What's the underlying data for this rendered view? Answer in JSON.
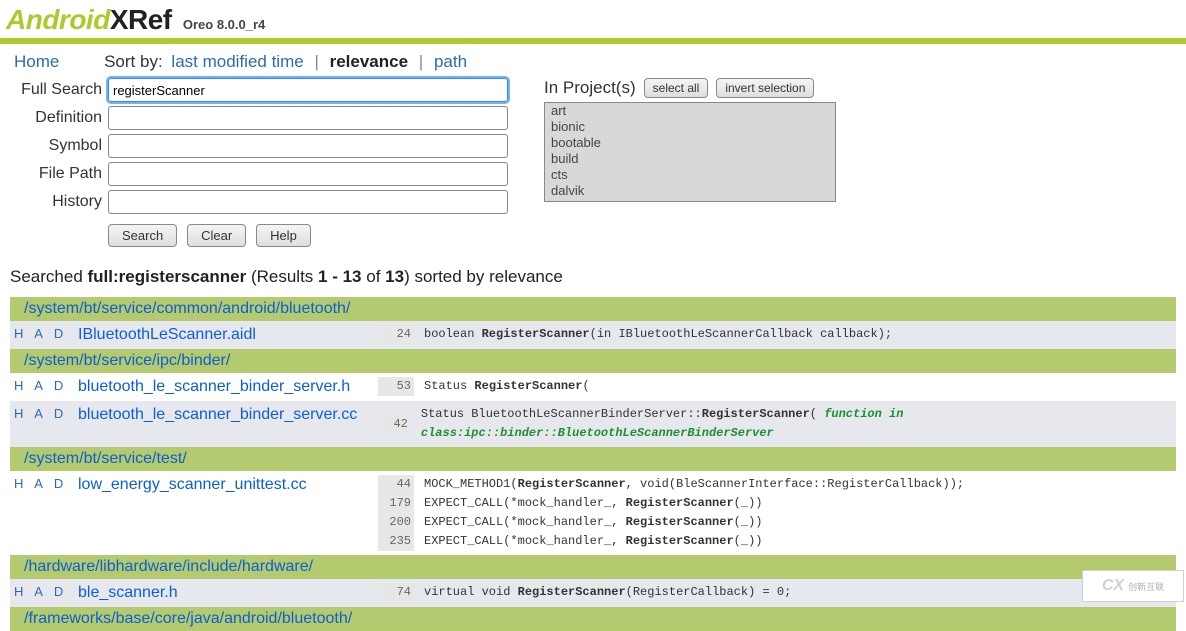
{
  "brand": {
    "part1": "Android",
    "part2": "XRef",
    "version": "Oreo 8.0.0_r4"
  },
  "nav": {
    "home": "Home",
    "sortby_label": "Sort by:",
    "sort_last": "last modified time",
    "sort_rel": "relevance",
    "sort_path": "path"
  },
  "form": {
    "labels": {
      "full": "Full Search",
      "def": "Definition",
      "symbol": "Symbol",
      "filepath": "File Path",
      "history": "History"
    },
    "values": {
      "full": "registerScanner",
      "def": "",
      "symbol": "",
      "filepath": "",
      "history": ""
    },
    "buttons": {
      "search": "Search",
      "clear": "Clear",
      "help": "Help"
    }
  },
  "projects": {
    "label": "In Project(s)",
    "select_all": "select all",
    "invert": "invert selection",
    "list": [
      "art",
      "bionic",
      "bootable",
      "build",
      "cts",
      "dalvik"
    ]
  },
  "summary": {
    "prefix": "Searched ",
    "query_label": "full:registerscanner",
    "mid1": " (Results ",
    "range": "1 - 13",
    "mid2": " of ",
    "total": "13",
    "suffix": ") sorted by relevance"
  },
  "results": [
    {
      "dir": "/system/bt/service/common/android/bluetooth/",
      "files": [
        {
          "row": "even",
          "had": "H A D",
          "name": "IBluetoothLeScanner.aidl",
          "hits": [
            {
              "line": "24",
              "pre": "boolean ",
              "kw": "RegisterScanner",
              "post": "(in IBluetoothLeScannerCallback callback);"
            }
          ]
        }
      ]
    },
    {
      "dir": "/system/bt/service/ipc/binder/",
      "files": [
        {
          "row": "odd",
          "had": "H A D",
          "name": "bluetooth_le_scanner_binder_server.h",
          "hits": [
            {
              "line": "53",
              "pre": "Status ",
              "kw": "RegisterScanner",
              "post": "("
            }
          ]
        },
        {
          "row": "even",
          "had": "H A D",
          "name": "bluetooth_le_scanner_binder_server.cc",
          "hits": [
            {
              "line": "42",
              "pre": "Status BluetoothLeScannerBinderServer::",
              "kw": "RegisterScanner",
              "post": "(  ",
              "fn": "function in class:ipc::binder::BluetoothLeScannerBinderServer"
            }
          ]
        }
      ]
    },
    {
      "dir": "/system/bt/service/test/",
      "files": [
        {
          "row": "odd",
          "had": "H A D",
          "name": "low_energy_scanner_unittest.cc",
          "hits": [
            {
              "line": "44",
              "pre": "MOCK_METHOD1(",
              "kw": "RegisterScanner",
              "post": ", void(BleScannerInterface::RegisterCallback));"
            },
            {
              "line": "179",
              "pre": "EXPECT_CALL(*mock_handler_, ",
              "kw": "RegisterScanner",
              "post": "(_))"
            },
            {
              "line": "200",
              "pre": "EXPECT_CALL(*mock_handler_, ",
              "kw": "RegisterScanner",
              "post": "(_))"
            },
            {
              "line": "235",
              "pre": "EXPECT_CALL(*mock_handler_, ",
              "kw": "RegisterScanner",
              "post": "(_))"
            }
          ]
        }
      ]
    },
    {
      "dir": "/hardware/libhardware/include/hardware/",
      "files": [
        {
          "row": "even",
          "had": "H A D",
          "name": "ble_scanner.h",
          "hits": [
            {
              "line": "74",
              "pre": "virtual void ",
              "kw": "RegisterScanner",
              "post": "(RegisterCallback) = 0;"
            }
          ]
        }
      ]
    },
    {
      "dir": "/frameworks/base/core/java/android/bluetooth/",
      "files": []
    }
  ],
  "watermark": {
    "icon": "CX",
    "text": "创新互联"
  }
}
